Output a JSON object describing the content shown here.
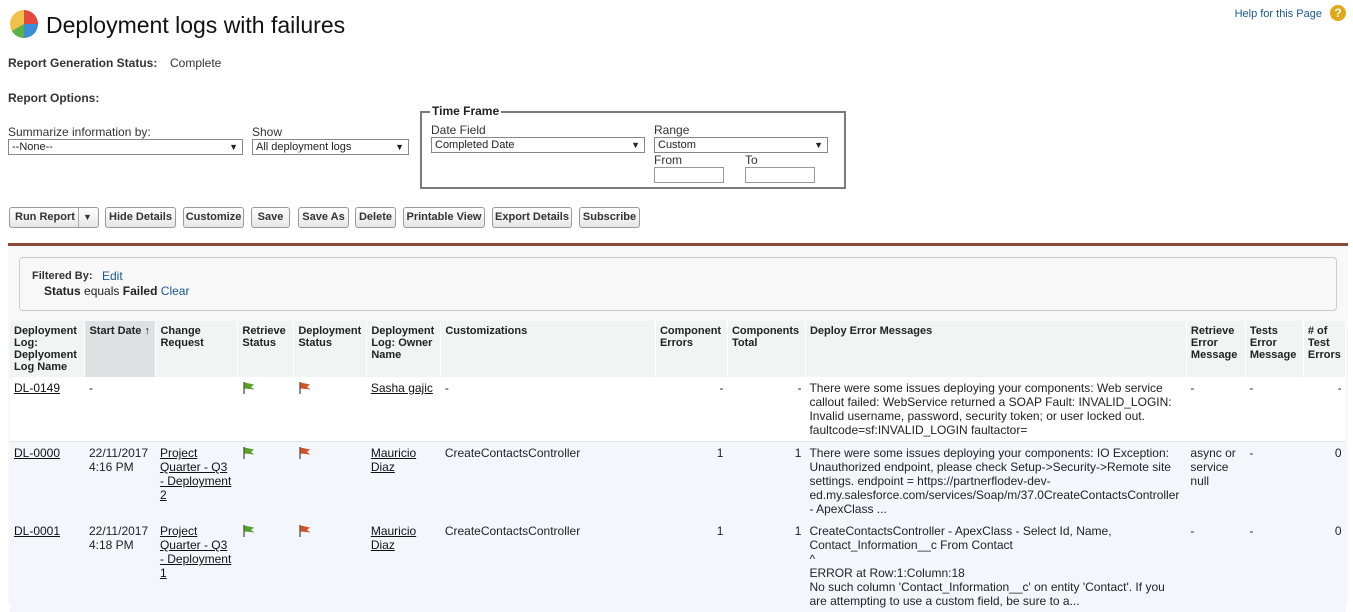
{
  "page": {
    "title": "Deployment logs with failures",
    "help_link": "Help for this Page",
    "help_icon": "question-icon"
  },
  "status": {
    "label": "Report Generation Status:",
    "value": "Complete"
  },
  "options": {
    "label": "Report Options:",
    "summarize_label": "Summarize information by:",
    "summarize_value": "--None--",
    "show_label": "Show",
    "show_value": "All deployment logs",
    "timeframe": {
      "legend": "Time Frame",
      "date_field_label": "Date Field",
      "date_field_value": "Completed Date",
      "range_label": "Range",
      "range_value": "Custom",
      "from_label": "From",
      "to_label": "To",
      "from_value": "",
      "to_value": ""
    }
  },
  "toolbar": {
    "run_report": "Run Report",
    "hide_details": "Hide Details",
    "customize": "Customize",
    "save": "Save",
    "save_as": "Save As",
    "delete": "Delete",
    "printable_view": "Printable View",
    "export_details": "Export Details",
    "subscribe": "Subscribe"
  },
  "filter": {
    "label": "Filtered By:",
    "edit": "Edit",
    "field": "Status",
    "operator": "equals",
    "value": "Failed",
    "clear": "Clear"
  },
  "table": {
    "headers": [
      "Deployment Log: Deplyoment Log Name",
      "Start Date ↑",
      "Change Request",
      "Retrieve Status",
      "Deployment Status",
      "Deployment Log: Owner Name",
      "Customizations",
      "Component Errors",
      "Components Total",
      "Deploy Error Messages",
      "Retrieve Error Message",
      "Tests Error Message",
      "# of Test Errors"
    ],
    "rows": [
      {
        "name": "DL-0149",
        "start_date": "-",
        "change_request": "",
        "owner": "Sasha gajic",
        "customizations": "-",
        "component_errors": "-",
        "components_total": "-",
        "deploy_error": "There were some issues deploying your components: Web service callout failed: WebService returned a SOAP Fault: INVALID_LOGIN: Invalid username, password, security token; or user locked out. faultcode=sf:INVALID_LOGIN faultactor=",
        "retrieve_error": "-",
        "tests_error": "-",
        "test_errors": "-"
      },
      {
        "name": "DL-0000",
        "start_date": "22/11/2017 4:16 PM",
        "change_request": "Project Quarter - Q3 - Deployment 2",
        "owner": "Mauricio Diaz",
        "customizations": "CreateContactsController",
        "component_errors": "1",
        "components_total": "1",
        "deploy_error": "There were some issues deploying your components: IO Exception: Unauthorized endpoint, please check Setup->Security->Remote site settings. endpoint = https://partnerflodev-dev-ed.my.salesforce.com/services/Soap/m/37.0CreateContactsController - ApexClass ...",
        "retrieve_error": "async or service null",
        "tests_error": "-",
        "test_errors": "0"
      },
      {
        "name": "DL-0001",
        "start_date": "22/11/2017 4:18 PM",
        "change_request": "Project Quarter - Q3 - Deployment 1",
        "owner": "Mauricio Diaz",
        "customizations": "CreateContactsController",
        "component_errors": "1",
        "components_total": "1",
        "deploy_error": "CreateContactsController - ApexClass - Select Id, Name, Contact_Information__c From Contact\n^\nERROR at Row:1:Column:18\nNo such column 'Contact_Information__c' on entity 'Contact'. If you are attempting to use a custom field, be sure to a...",
        "retrieve_error": "-",
        "tests_error": "-",
        "test_errors": "0"
      }
    ]
  },
  "colors": {
    "retrieve_flag": "#5aa02c",
    "deploy_flag": "#d2532b",
    "accent_line": "#8c4a3a"
  }
}
